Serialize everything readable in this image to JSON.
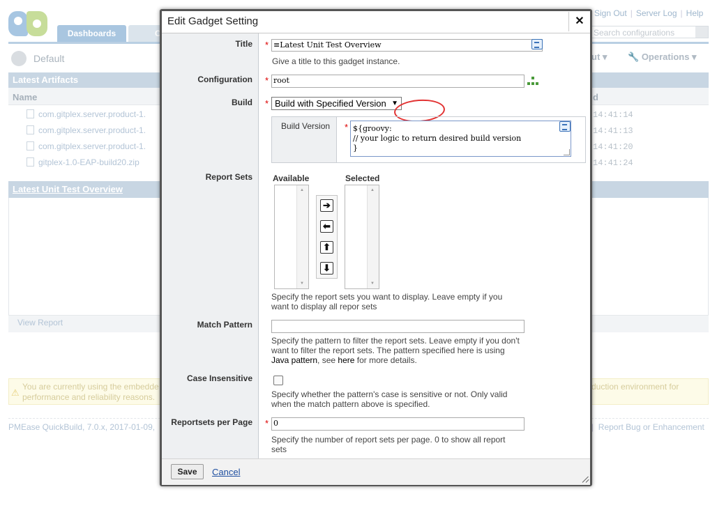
{
  "background": {
    "tabs": {
      "dashboards": "Dashboards",
      "second": "C"
    },
    "top_links": [
      "Sign Out",
      "Server Log",
      "Help"
    ],
    "search_placeholder": "Search configurations",
    "dashboard_name": "Default",
    "menus": {
      "partial": "ut",
      "operations": "Operations"
    },
    "artifacts": {
      "title": "Latest Artifacts",
      "col_name": "Name",
      "col_date_partial": "d",
      "rows": [
        {
          "name": "com.gitplex.server.product-1.",
          "time": "14:41:14"
        },
        {
          "name": "com.gitplex.server.product-1.",
          "time": "14:41:13"
        },
        {
          "name": "com.gitplex.server.product-1.",
          "time": "14:41:20"
        },
        {
          "name": "gitplex-1.0-EAP-build20.zip",
          "time": "14:41:24"
        }
      ]
    },
    "unit_test": {
      "title": "Latest Unit Test Overview",
      "view_report": "View Report"
    },
    "warning": {
      "left_line1": "You are currently using the embedde",
      "left_line2": "performance and reliability reasons.",
      "right": "duction environment for"
    },
    "footer": {
      "left": "PMEase QuickBuild, 7.0.x, 2017-01-09,",
      "right": "Report Bug or Enhancement"
    }
  },
  "dialog": {
    "title": "Edit Gadget Setting",
    "close": "✕",
    "fields": {
      "title": {
        "label": "Title",
        "value": "Latest Unit Test Overview",
        "help": "Give a title to this gadget instance."
      },
      "configuration": {
        "label": "Configuration",
        "value": "root"
      },
      "build": {
        "label": "Build",
        "selected": "Build with Specified Version",
        "build_version_label": "Build Version",
        "build_version_value": "${groovy:\n// your logic to return desired build version\n}"
      },
      "report_sets": {
        "label": "Report Sets",
        "available": "Available",
        "selected": "Selected",
        "help_line1": "Specify the report sets you want to display. Leave empty if you",
        "help_line2": "want to display all repor sets"
      },
      "match_pattern": {
        "label": "Match Pattern",
        "value": "",
        "help_line1": "Specify the pattern to filter the report sets. Leave empty if you don't",
        "help_line2": "want to filter the report sets. The pattern specified here is using",
        "help_line3a": "Java pattern",
        "help_line3b": ", see ",
        "help_line3c": "here",
        "help_line3d": " for more details."
      },
      "case_insensitive": {
        "label": "Case Insensitive",
        "checked": false,
        "help_line1": "Specify whether the pattern's case is sensitive or not. Only valid",
        "help_line2": "when the match pattern above is specified."
      },
      "reportsets_per_page": {
        "label": "Reportsets per Page",
        "value": "0",
        "help_line1": "Specify the number of report sets per page. 0 to show all report",
        "help_line2": "sets"
      }
    },
    "required_marker": "*",
    "buttons": {
      "save": "Save",
      "cancel": "Cancel"
    }
  },
  "colors": {
    "accent": "#a9c6e0",
    "annotation": "#e23232",
    "link": "#1f4fa0"
  }
}
